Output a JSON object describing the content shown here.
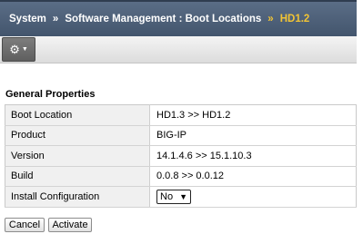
{
  "breadcrumb": {
    "items": [
      "System",
      "Software Management : Boot Locations"
    ],
    "current": "HD1.2",
    "separator": "»"
  },
  "toolbar": {
    "gear_icon": "gear-icon",
    "caret_icon": "chevron-down-icon"
  },
  "section": {
    "title": "General Properties"
  },
  "properties": [
    {
      "label": "Boot Location",
      "value": "HD1.3 >> HD1.2"
    },
    {
      "label": "Product",
      "value": "BIG-IP"
    },
    {
      "label": "Version",
      "value": "14.1.4.6 >> 15.1.10.3"
    },
    {
      "label": "Build",
      "value": "0.0.8 >> 0.0.12"
    },
    {
      "label": "Install Configuration",
      "select_value": "No"
    }
  ],
  "buttons": {
    "cancel": "Cancel",
    "activate": "Activate"
  },
  "colors": {
    "titlebar": "#4f627b",
    "current_crumb": "#f2c434",
    "label_bg": "#f0f0f0"
  }
}
